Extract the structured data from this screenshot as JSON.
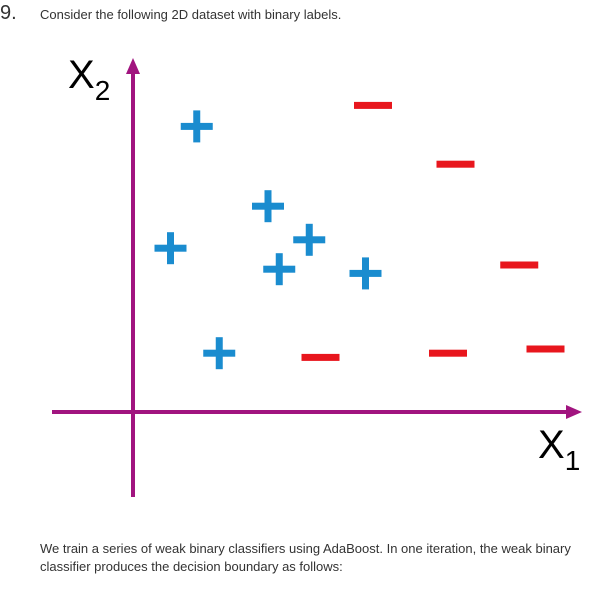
{
  "question": {
    "number": "9.",
    "prompt": "Consider the following 2D dataset with binary labels."
  },
  "figure": {
    "axes": {
      "x_label_main": "X",
      "x_label_sub": "1",
      "y_label_main": "X",
      "y_label_sub": "2",
      "axis_color": "#a1147f"
    },
    "positive_color": "#1a8ccf",
    "negative_color": "#e8161d",
    "points": [
      {
        "label": "positive",
        "x": 0.85,
        "y": 6.8
      },
      {
        "label": "positive",
        "x": 1.8,
        "y": 4.9
      },
      {
        "label": "positive",
        "x": 2.35,
        "y": 4.1
      },
      {
        "label": "positive",
        "x": 0.5,
        "y": 3.9
      },
      {
        "label": "positive",
        "x": 1.95,
        "y": 3.4
      },
      {
        "label": "positive",
        "x": 3.1,
        "y": 3.3
      },
      {
        "label": "positive",
        "x": 1.15,
        "y": 1.4
      },
      {
        "label": "negative",
        "x": 3.2,
        "y": 7.3
      },
      {
        "label": "negative",
        "x": 4.3,
        "y": 5.9
      },
      {
        "label": "negative",
        "x": 5.15,
        "y": 3.5
      },
      {
        "label": "negative",
        "x": 2.5,
        "y": 1.3
      },
      {
        "label": "negative",
        "x": 4.2,
        "y": 1.4
      },
      {
        "label": "negative",
        "x": 5.5,
        "y": 1.5
      }
    ]
  },
  "footer": {
    "text": "We train a series of weak binary classifiers using AdaBoost. In one iteration, the weak binary classifier produces the decision boundary as follows:"
  }
}
